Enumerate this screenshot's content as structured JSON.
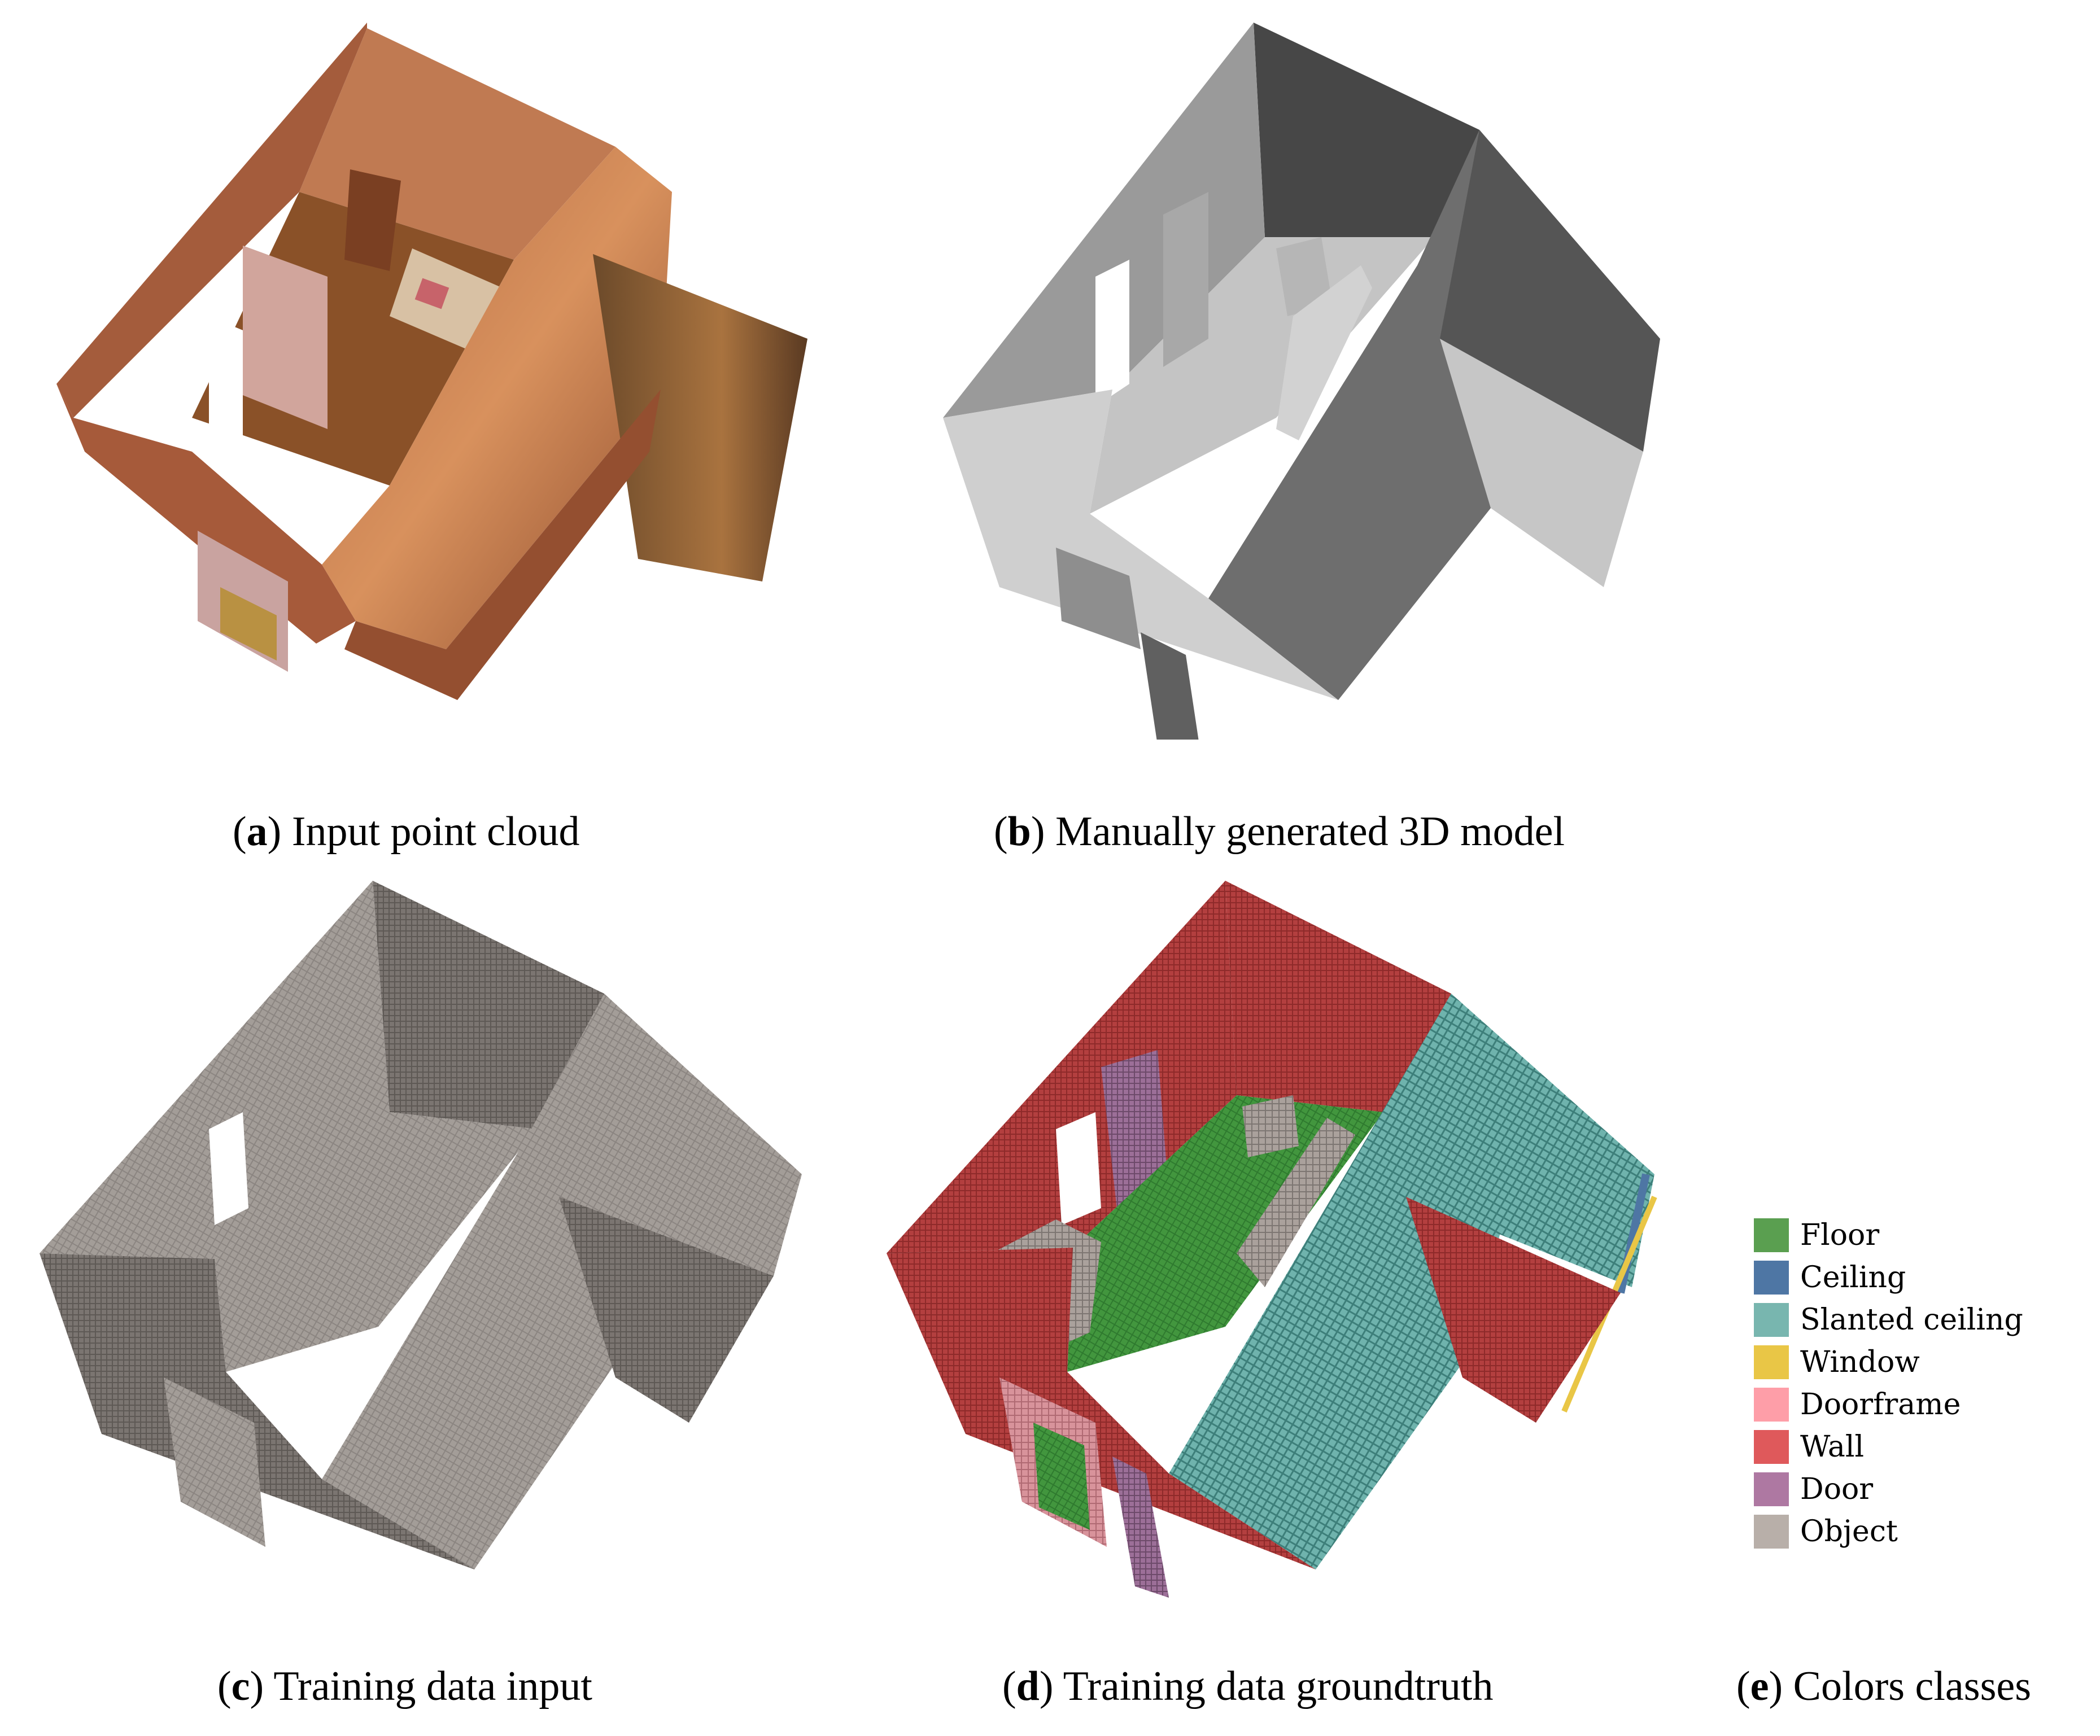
{
  "figure": {
    "panels": [
      {
        "id": "a",
        "letter": "a",
        "caption": " Input point cloud",
        "kind": "point-cloud"
      },
      {
        "id": "b",
        "letter": "b",
        "caption": " Manually generated 3D model",
        "kind": "mesh-model"
      },
      {
        "id": "c",
        "letter": "c",
        "caption": " Training data input",
        "kind": "voxel-grey"
      },
      {
        "id": "d",
        "letter": "d",
        "caption": " Training data groundtruth",
        "kind": "voxel-labeled"
      },
      {
        "id": "e",
        "letter": "e",
        "caption": " Colors classes",
        "kind": "legend"
      }
    ],
    "legend": [
      {
        "label": "Floor",
        "color": "#5a9f50"
      },
      {
        "label": "Ceiling",
        "color": "#4e76a4"
      },
      {
        "label": "Slanted ceiling",
        "color": "#78b6af"
      },
      {
        "label": "Window",
        "color": "#e9c646"
      },
      {
        "label": "Doorframe",
        "color": "#fe9ea8"
      },
      {
        "label": "Wall",
        "color": "#df595b"
      },
      {
        "label": "Door",
        "color": "#ae78a2"
      },
      {
        "label": "Object",
        "color": "#b8afa9"
      }
    ]
  }
}
